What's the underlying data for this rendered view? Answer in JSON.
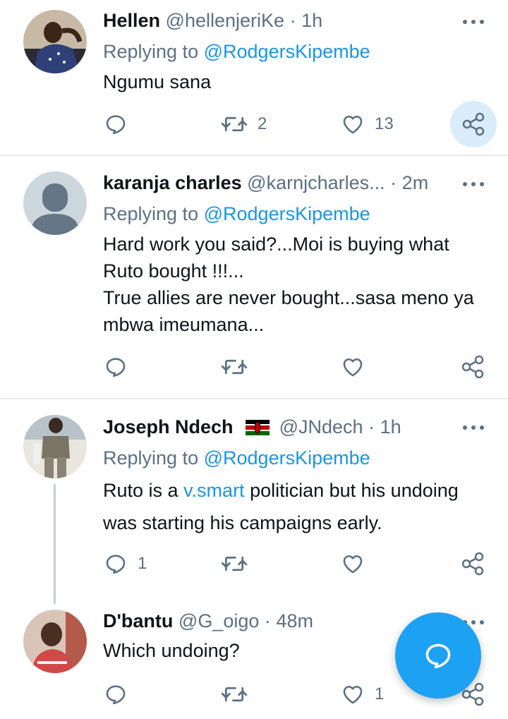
{
  "colors": {
    "accent": "#1b95e0",
    "fab": "#1da1f2",
    "muted": "#5b7083",
    "divider": "#e6ecf0"
  },
  "tweets": [
    {
      "name": "Hellen",
      "handle": "@hellenjeriKe",
      "time": "1h",
      "replying_prefix": "Replying to",
      "replying_to": "@RodgersKipembe",
      "text_lines": [
        "Ngumu sana"
      ],
      "retweets": "2",
      "likes": "13"
    },
    {
      "name": "karanja charles",
      "handle": "@karnjcharles...",
      "time": "2m",
      "replying_prefix": "Replying to",
      "replying_to": "@RodgersKipembe",
      "text_lines": [
        "Hard work you said?...Moi is buying what",
        "Ruto bought !!!...",
        "True allies are never bought...sasa meno ya",
        "mbwa imeumana..."
      ]
    },
    {
      "name": "Joseph Ndech",
      "handle": "@JNdech",
      "time": "1h",
      "replying_prefix": "Replying to",
      "replying_to": "@RodgersKipembe",
      "text_before_link": "Ruto is a ",
      "text_link": "v.smart",
      "text_after_link": " politician but his undoing",
      "text_line2": "was starting his campaigns early.",
      "replies": "1"
    },
    {
      "name": "D'bantu",
      "handle": "@G_oigo",
      "time": "48m",
      "text_lines": [
        "Which undoing?"
      ],
      "likes": "1"
    }
  ],
  "icons": {
    "more": "more-dots-icon",
    "reply": "reply-icon",
    "retweet": "retweet-icon",
    "like": "heart-icon",
    "share": "share-icon",
    "compose": "compose-reply-icon",
    "flag": "kenya-flag-icon"
  }
}
